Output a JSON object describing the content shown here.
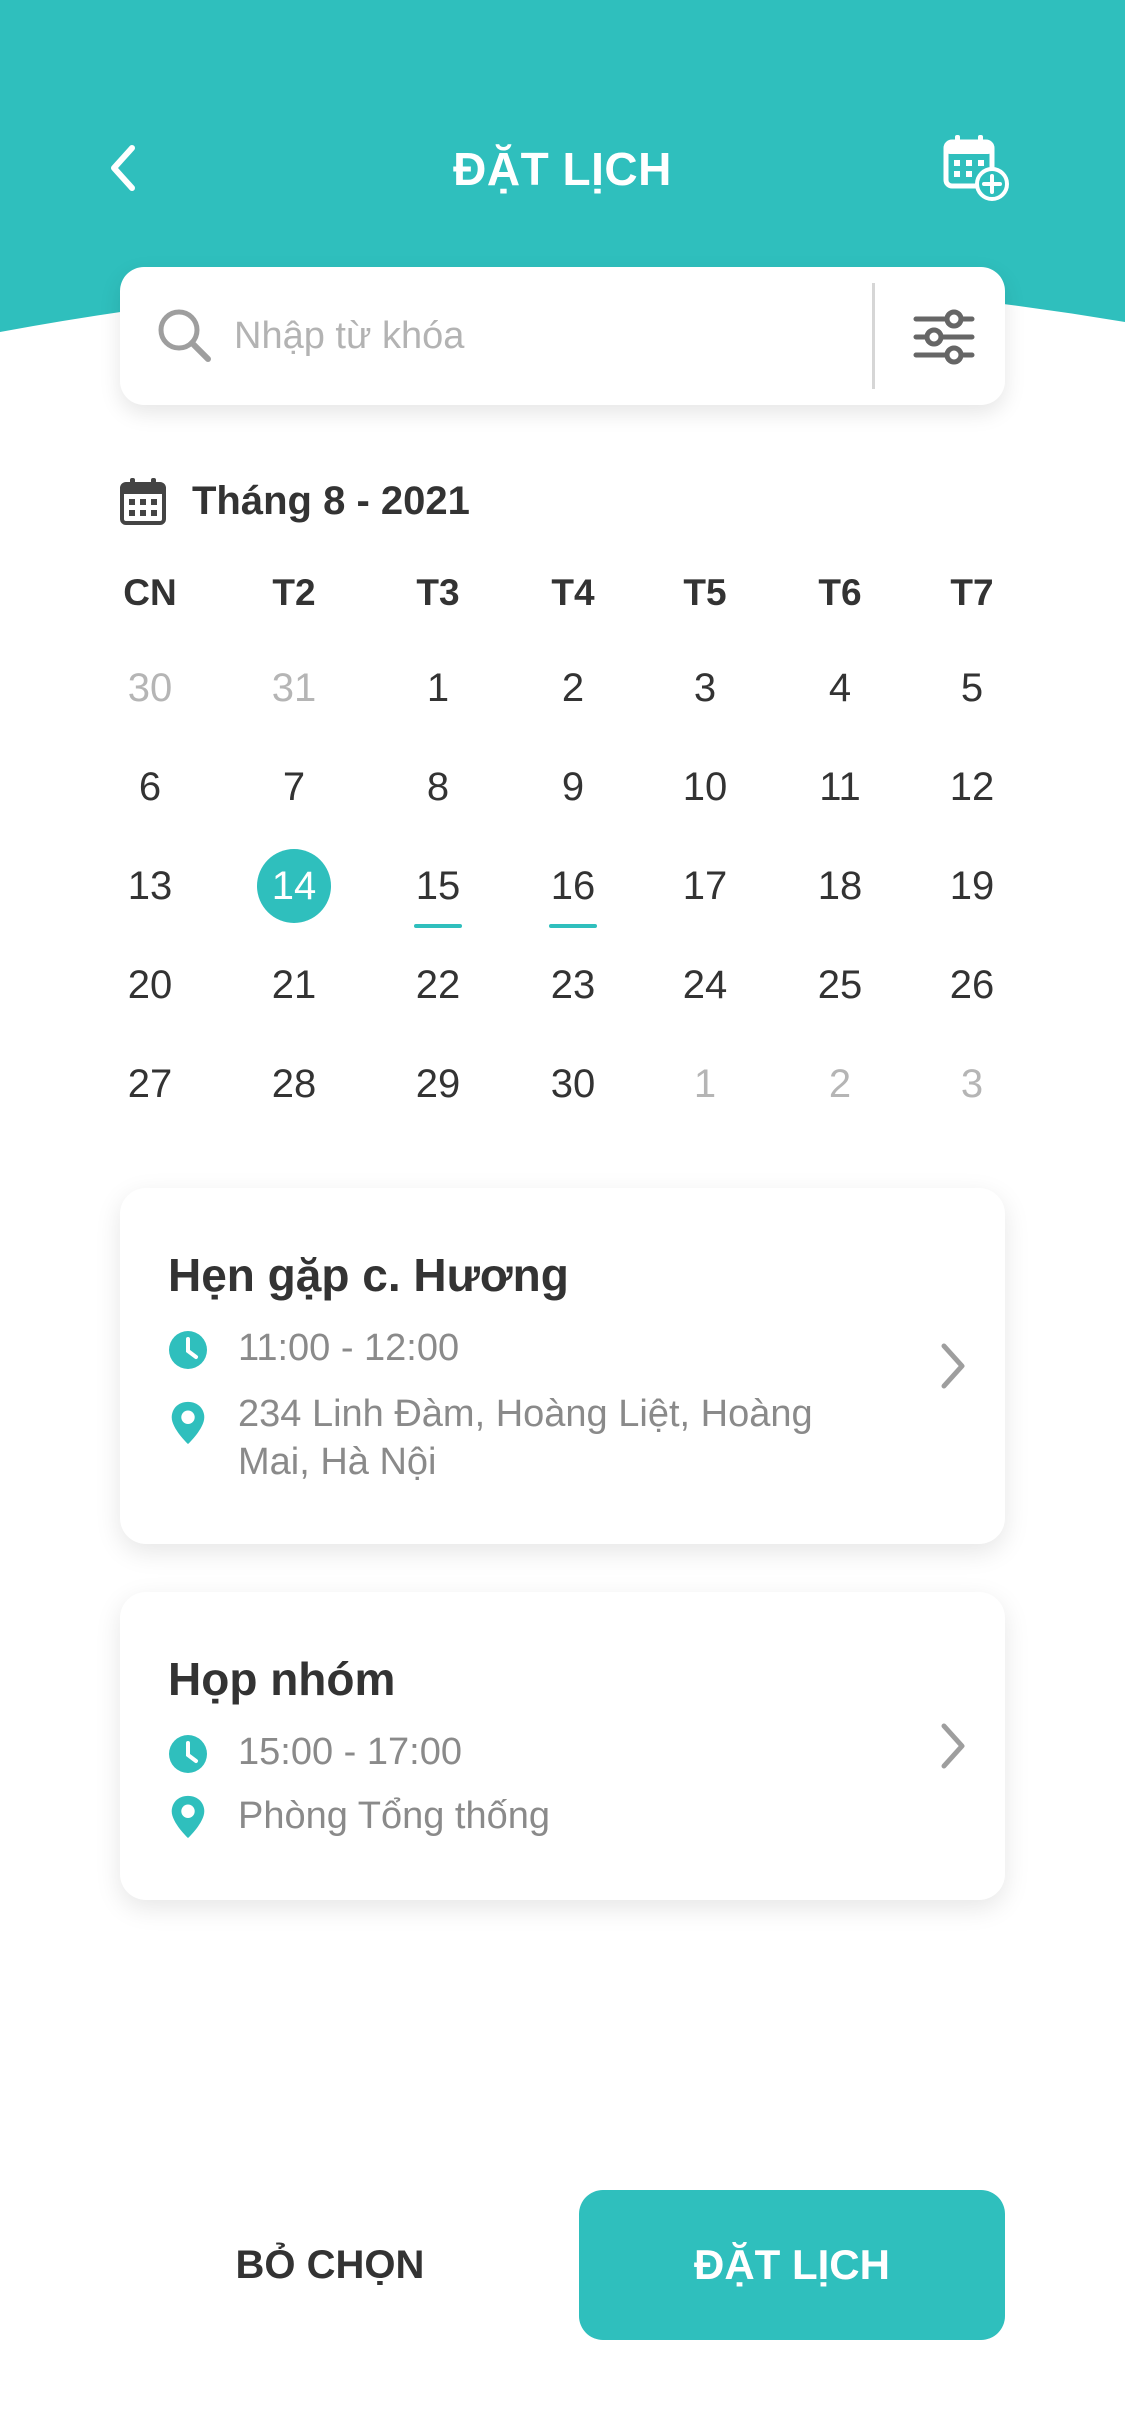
{
  "colors": {
    "accent": "#2fbfbd",
    "text": "#333333",
    "muted": "#b5b5b5",
    "subtext": "#8a8a8a"
  },
  "header": {
    "title": "ĐẶT LỊCH"
  },
  "search": {
    "placeholder": "Nhập từ khóa"
  },
  "calendar": {
    "month_label": "Tháng 8 - 2021",
    "weekdays": [
      "CN",
      "T2",
      "T3",
      "T4",
      "T5",
      "T6",
      "T7"
    ],
    "weeks": [
      [
        "30",
        "31",
        "1",
        "2",
        "3",
        "4",
        "5"
      ],
      [
        "6",
        "7",
        "8",
        "9",
        "10",
        "11",
        "12"
      ],
      [
        "13",
        "14",
        "15",
        "16",
        "17",
        "18",
        "19"
      ],
      [
        "20",
        "21",
        "22",
        "23",
        "24",
        "25",
        "26"
      ],
      [
        "27",
        "28",
        "29",
        "30",
        "1",
        "2",
        "3"
      ]
    ],
    "selected": "14",
    "marked": [
      "15",
      "16"
    ]
  },
  "events": [
    {
      "title": "Hẹn gặp c. Hương",
      "time": "11:00 - 12:00",
      "location": "234 Linh Đàm, Hoàng Liệt, Hoàng Mai, Hà Nội"
    },
    {
      "title": "Họp nhóm",
      "time": "15:00 - 17:00",
      "location": "Phòng Tổng thống"
    }
  ],
  "actions": {
    "clear_label": "BỎ CHỌN",
    "book_label": "ĐẶT LỊCH"
  }
}
